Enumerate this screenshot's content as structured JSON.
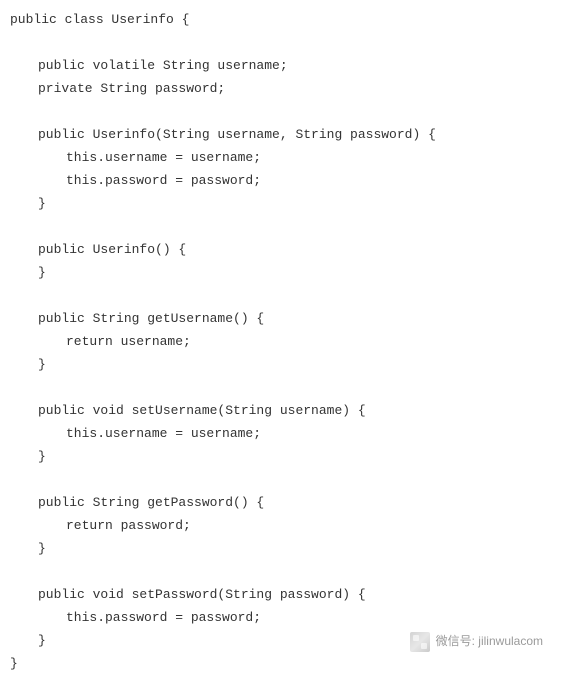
{
  "code": {
    "lines": [
      {
        "cls": "",
        "text": "public class Userinfo {"
      },
      {
        "cls": "",
        "text": ""
      },
      {
        "cls": "indent-1",
        "text": "public volatile String username;"
      },
      {
        "cls": "indent-1",
        "text": "private String password;"
      },
      {
        "cls": "",
        "text": ""
      },
      {
        "cls": "indent-1",
        "text": "public Userinfo(String username, String password) {"
      },
      {
        "cls": "indent-2",
        "text": "this.username = username;"
      },
      {
        "cls": "indent-2",
        "text": "this.password = password;"
      },
      {
        "cls": "indent-1",
        "text": "}"
      },
      {
        "cls": "",
        "text": ""
      },
      {
        "cls": "indent-1",
        "text": "public Userinfo() {"
      },
      {
        "cls": "indent-1",
        "text": "}"
      },
      {
        "cls": "",
        "text": ""
      },
      {
        "cls": "indent-1",
        "text": "public String getUsername() {"
      },
      {
        "cls": "indent-2",
        "text": "return username;"
      },
      {
        "cls": "indent-1",
        "text": "}"
      },
      {
        "cls": "",
        "text": ""
      },
      {
        "cls": "indent-1",
        "text": "public void setUsername(String username) {"
      },
      {
        "cls": "indent-2",
        "text": "this.username = username;"
      },
      {
        "cls": "indent-1",
        "text": "}"
      },
      {
        "cls": "",
        "text": ""
      },
      {
        "cls": "indent-1",
        "text": "public String getPassword() {"
      },
      {
        "cls": "indent-2",
        "text": "return password;"
      },
      {
        "cls": "indent-1",
        "text": "}"
      },
      {
        "cls": "",
        "text": ""
      },
      {
        "cls": "indent-1",
        "text": "public void setPassword(String password) {"
      },
      {
        "cls": "indent-2",
        "text": "this.password = password;"
      },
      {
        "cls": "indent-1",
        "text": "}"
      },
      {
        "cls": "",
        "text": "}"
      }
    ]
  },
  "watermark": {
    "label": "微信号: jilinwulacom"
  }
}
